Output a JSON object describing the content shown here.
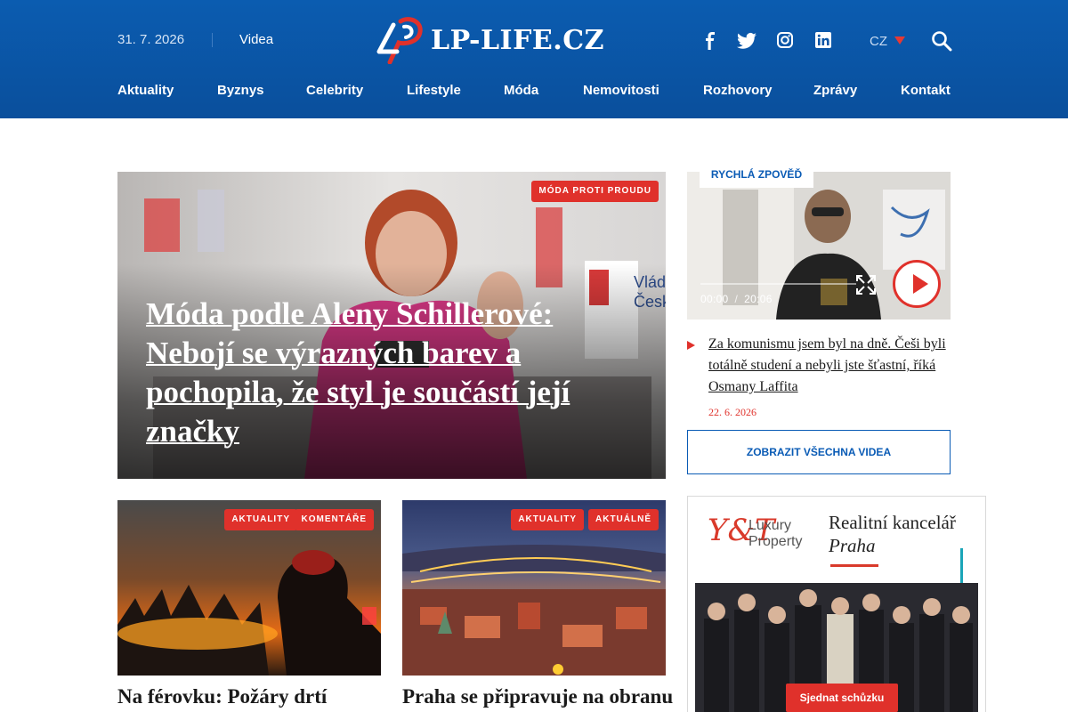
{
  "header": {
    "date": "31. 7. 2026",
    "videos_link": "Videa",
    "logo_text": "LP-LIFE.CZ",
    "language": "CZ",
    "social": [
      "facebook-icon",
      "twitter-icon",
      "instagram-icon",
      "linkedin-icon"
    ]
  },
  "nav": {
    "items": [
      "Aktuality",
      "Byznys",
      "Celebrity",
      "Lifestyle",
      "Móda",
      "Nemovitosti",
      "Rozhovory",
      "Zprávy",
      "Kontakt"
    ]
  },
  "hero": {
    "tag": "MÓDA PROTI PROUDU",
    "title": "Móda podle Aleny Schillerové: Nebojí se výrazných barev a pochopila, že styl je součástí její značky"
  },
  "cards": [
    {
      "tags": [
        "AKTUALITY",
        "KOMENTÁŘE"
      ],
      "title": "Na férovku: Požáry drtí"
    },
    {
      "tags": [
        "AKTUALITY",
        "AKTUÁLNĚ"
      ],
      "title": "Praha se připravuje na obranu"
    }
  ],
  "video": {
    "label": "RYCHLÁ ZPOVĚĎ",
    "current_time": "00:00",
    "time_separator": "/",
    "duration": "20:06",
    "article_title": "Za komunismu jsem byl na dně. Češi byli totálně studení a nebyli jste šťastní, říká Osmany Laffita",
    "article_date": "22. 6. 2026",
    "all_videos_button": "ZOBRAZIT VŠECHNA VIDEA"
  },
  "ad": {
    "brand_mark": "Y&T",
    "brand_line1": "Luxury",
    "brand_line2": "Property",
    "title": "Realitní kancelář",
    "city": "Praha",
    "cta": "Sjednat schůzku"
  },
  "colors": {
    "header_blue": "#0a55a6",
    "accent_red": "#e0312b",
    "link_blue": "#0a5bb5"
  }
}
